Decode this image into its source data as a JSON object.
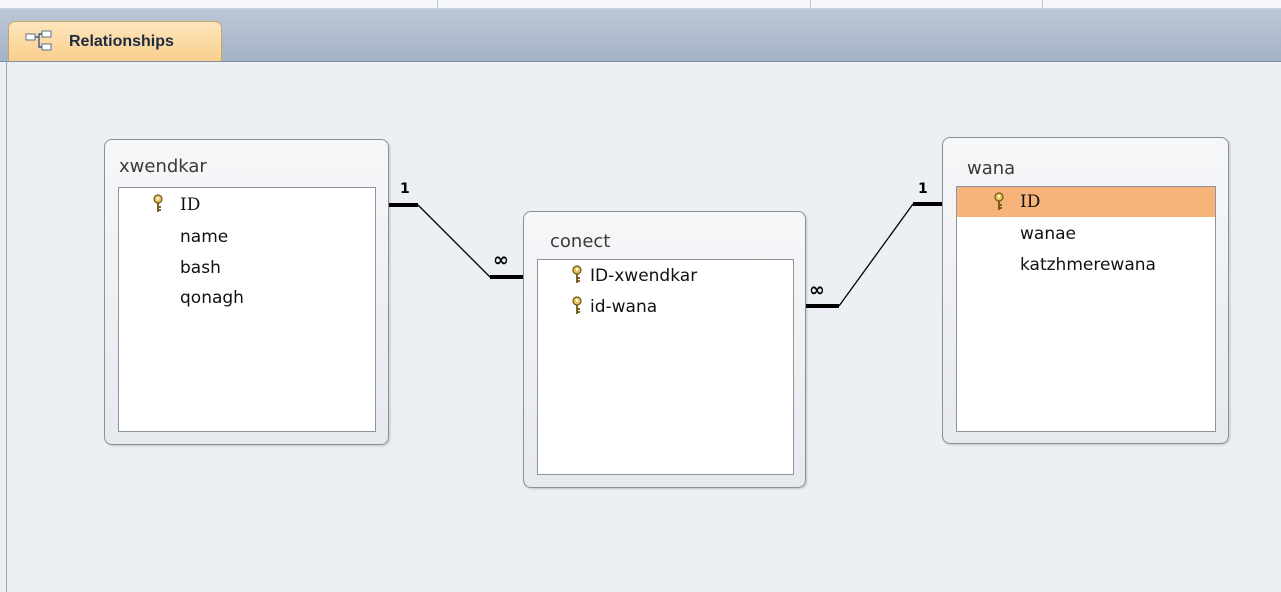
{
  "window": {
    "tab": {
      "label": "Relationships",
      "icon": "relationships-icon"
    }
  },
  "tables": {
    "xwendkar": {
      "title": "xwendkar",
      "fields": [
        "ID",
        "name",
        "bash",
        "qonagh"
      ]
    },
    "conect": {
      "title": "conect",
      "fields": [
        "ID-xwendkar",
        "id-wana"
      ]
    },
    "wana": {
      "title": "wana",
      "fields": [
        "ID",
        "wanae",
        "katzhmerewana"
      ],
      "selected_field": "ID"
    }
  },
  "relationships": {
    "xwendkar_conect": {
      "one_label": "1",
      "many_label": "∞"
    },
    "wana_conect": {
      "one_label": "1",
      "many_label": "∞"
    }
  },
  "colors": {
    "tab_active": "#f9cf8c",
    "selected_field": "#f6b47a",
    "canvas": "#eceff3"
  }
}
